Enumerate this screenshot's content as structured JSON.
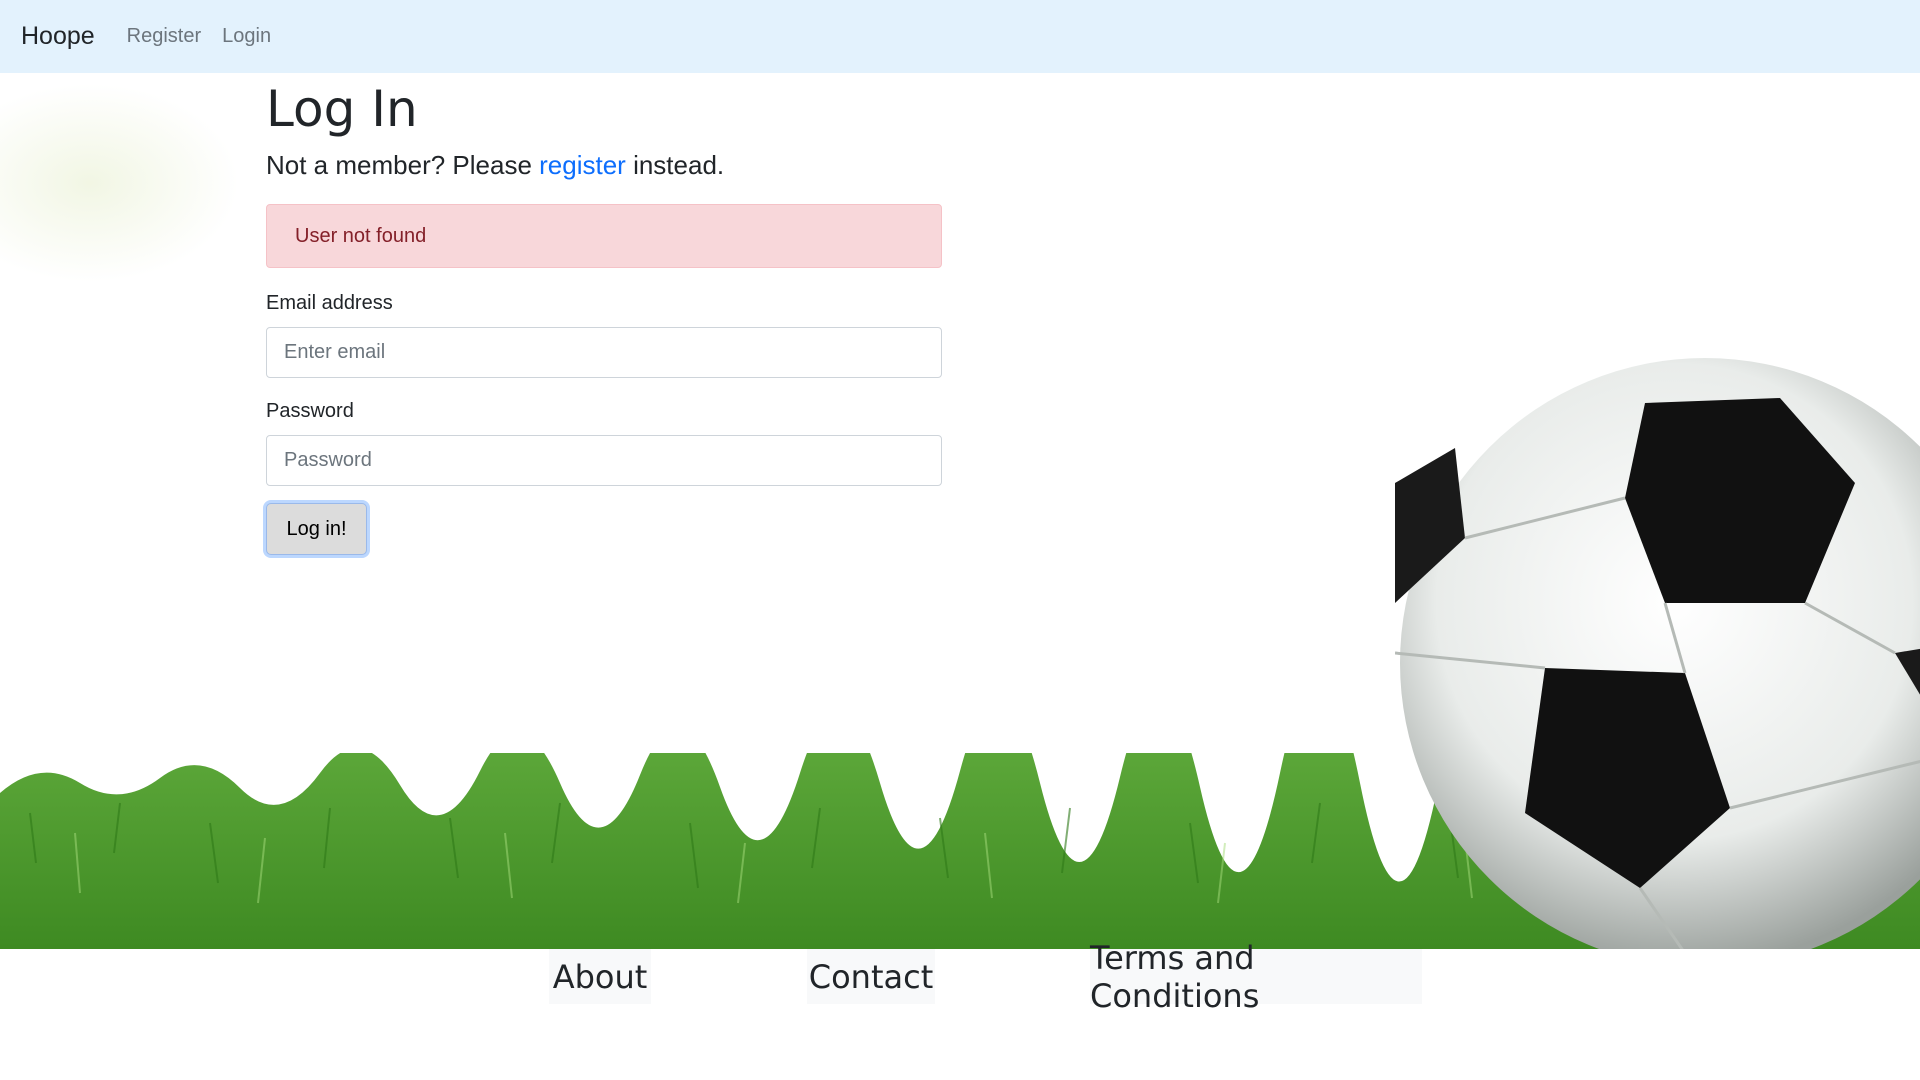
{
  "navbar": {
    "brand": "Hoope",
    "links": [
      "Register",
      "Login"
    ]
  },
  "page": {
    "title": "Log In",
    "subtitle_before": "Not a member? Please ",
    "subtitle_link": "register",
    "subtitle_after": " instead."
  },
  "alert": {
    "message": "User not found"
  },
  "form": {
    "email_label": "Email address",
    "email_placeholder": "Enter email",
    "email_value": "",
    "password_label": "Password",
    "password_placeholder": "Password",
    "password_value": "",
    "submit_label": "Log in!"
  },
  "footer": {
    "links": [
      "About",
      "Contact",
      "Terms and Conditions"
    ]
  },
  "colors": {
    "navbar_bg": "#e3f2fd",
    "link_blue": "#0d6efd",
    "alert_bg": "#f8d7da",
    "alert_text": "#842029",
    "grass_green": "#4a9a2a"
  },
  "icons": [
    "soccer-ball-image",
    "grass-image"
  ]
}
